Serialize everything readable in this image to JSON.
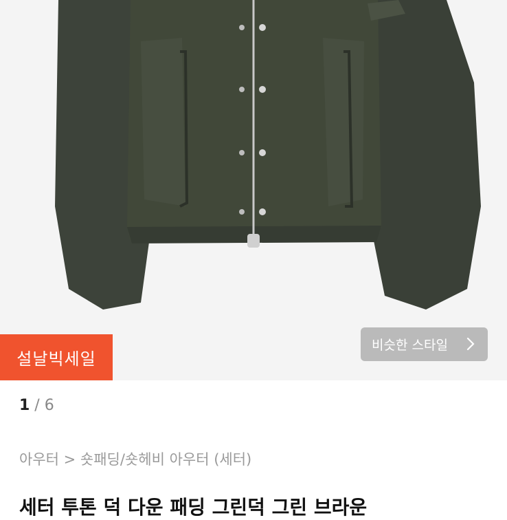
{
  "badge": {
    "sale_label": "설날빅세일"
  },
  "similar_style": {
    "label": "비슷한 스타일",
    "icon": "chevron-right-icon"
  },
  "gallery": {
    "current": "1",
    "separator": " / ",
    "total": "6"
  },
  "breadcrumb": {
    "text": "아우터 > 숏패딩/숏헤비 아우터 (세터)"
  },
  "product": {
    "title": "세터 투톤 덕 다운 패딩 그린덕 그린 브라운"
  },
  "colors": {
    "sale": "#f0532e",
    "jacket": "#3b4237"
  }
}
